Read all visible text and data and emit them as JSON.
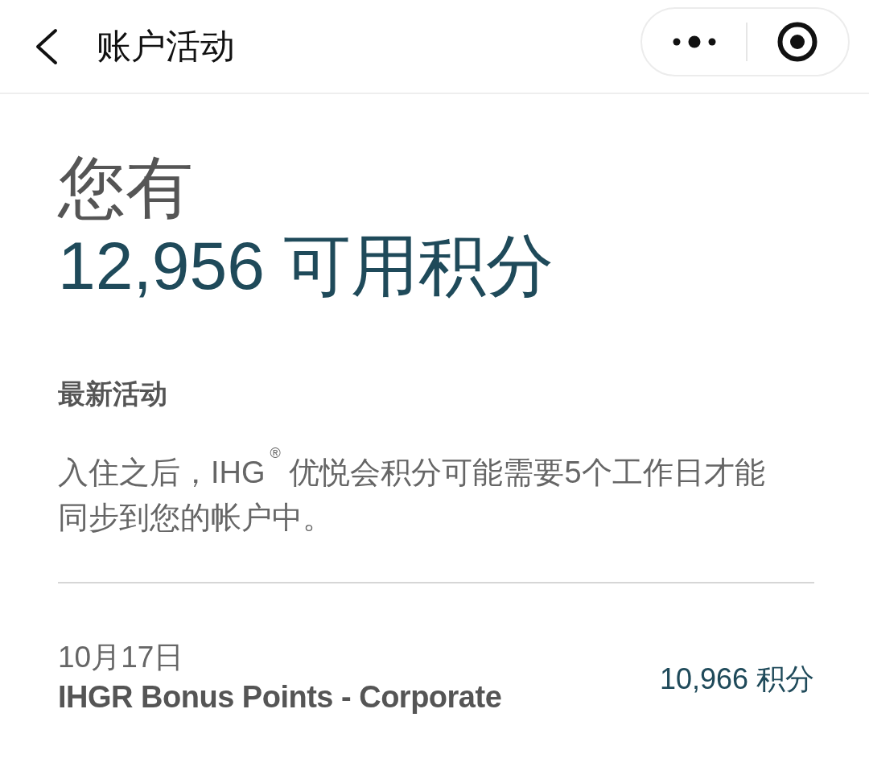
{
  "header": {
    "title": "账户活动"
  },
  "summary": {
    "prefix": "您有",
    "points": "12,956 可用积分"
  },
  "recent": {
    "heading": "最新活动",
    "note": "入住之后，IHG$^{®}$ 优悦会积分可能需要5个工作日才能同步到您的帐户中。"
  },
  "activities": [
    {
      "date": "10月17日",
      "description": "IHGR Bonus Points - Corporate",
      "amount": "10,966 积分"
    }
  ]
}
